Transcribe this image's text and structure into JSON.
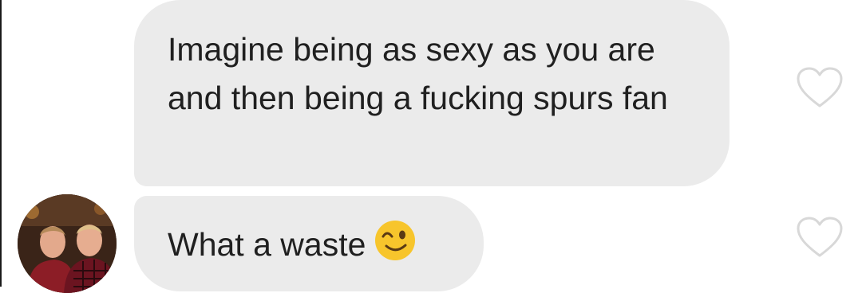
{
  "messages": [
    {
      "text": "Imagine being as sexy as you are and then being a fucking spurs fan",
      "icon": "heart-outline-icon"
    },
    {
      "text": "What a waste",
      "emoji": "winking-face-emoji",
      "icon": "heart-outline-icon"
    }
  ],
  "sender": {
    "avatar": "profile-photo-two-men"
  },
  "colors": {
    "bubble": "#ebebeb",
    "text": "#202020",
    "heart_stroke": "#d8d8d8",
    "emoji_face": "#f7c52c"
  }
}
